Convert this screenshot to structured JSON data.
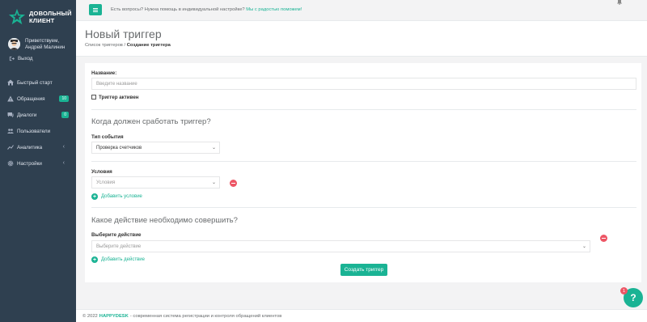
{
  "app": {
    "logo_line1": "ДОВОЛЬНЫЙ",
    "logo_line2": "КЛИЕНТ",
    "accent": "#1ab394",
    "sidebar_bg": "#2f4050",
    "danger": "#ed5565"
  },
  "profile": {
    "greeting": "Приветствуем,",
    "name": "Андрей Малинин",
    "logout": "Выход"
  },
  "sidebar": {
    "items": [
      {
        "label": "Быстрый старт",
        "icon": "home-icon"
      },
      {
        "label": "Обращения",
        "icon": "warning-icon",
        "badge": "10"
      },
      {
        "label": "Диалоги",
        "icon": "chat-icon",
        "badge": "0"
      },
      {
        "label": "Пользователи",
        "icon": "users-icon"
      },
      {
        "label": "Аналитика",
        "icon": "chart-icon",
        "expand": "‹"
      },
      {
        "label": "Настройки",
        "icon": "gear-icon",
        "expand": "‹"
      }
    ]
  },
  "topbar": {
    "help_text": "Есть вопросы? Нужна помощь в индивидуальной настройке?",
    "help_link": "Мы с радостью поможем!"
  },
  "header": {
    "title": "Новый триггер",
    "breadcrumb_parent": "Список триггеров",
    "breadcrumb_sep": "/",
    "breadcrumb_current": "Создание триггера"
  },
  "form": {
    "name_label": "Название:",
    "name_placeholder": "Введите название",
    "active_label": "Триггер активен",
    "section1": "Когда должен сработать триггер?",
    "event_label": "Тип события",
    "event_value": "Проверка счетчиков",
    "conditions_label": "Условия",
    "conditions_placeholder": "Условия",
    "add_condition": "Добавить условие",
    "section2": "Какое действие необходимо совершить?",
    "action_label": "Выберите действие",
    "action_placeholder": "Выберите действие",
    "add_action": "Добавить действие",
    "submit": "Создать триггер"
  },
  "footer": {
    "prefix": "© 2022",
    "brand": "HAPPYDESK",
    "suffix": "- современная система регистрации и контроля обращений клиентов"
  },
  "help_widget": {
    "label": "?",
    "badge": "1"
  }
}
